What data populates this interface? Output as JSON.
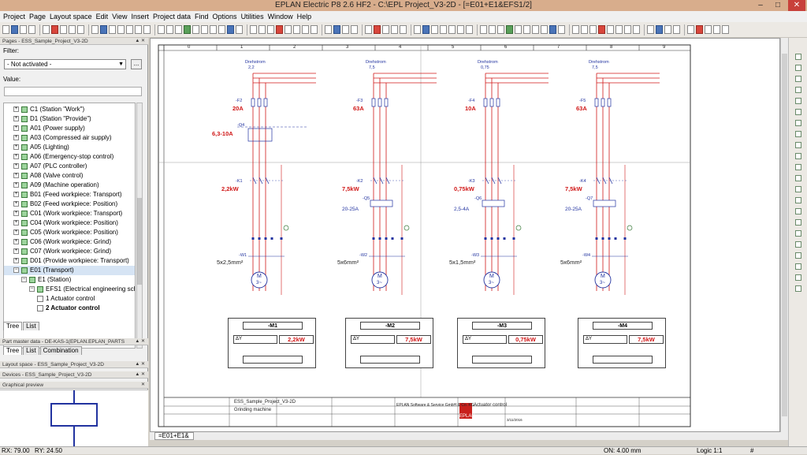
{
  "window": {
    "title": "EPLAN Electric P8 2.6 HF2 - C:\\EPL                               Project_V3-2D - [=E01+E1&EFS1/2]"
  },
  "menu": [
    "Project",
    "Page",
    "Layout space",
    "Edit",
    "View",
    "Insert",
    "Project data",
    "Find",
    "Options",
    "Utilities",
    "Window",
    "Help"
  ],
  "pages_panel": {
    "header": "Pages - ESS_Sample_Project_V3-2D",
    "filter_label": "Filter:",
    "filter_value": "- Not activated -",
    "filter_button": "...",
    "value_label": "Value:",
    "tree": [
      {
        "label": "C1 (Station \"Work\")",
        "level": 0,
        "icon": "station"
      },
      {
        "label": "D1 (Station \"Provide\")",
        "level": 0,
        "icon": "station"
      },
      {
        "label": "A01 (Power supply)",
        "level": 0,
        "icon": "location"
      },
      {
        "label": "A03 (Compressed air supply)",
        "level": 0,
        "icon": "location"
      },
      {
        "label": "A05 (Lighting)",
        "level": 0,
        "icon": "location"
      },
      {
        "label": "A06 (Emergency-stop control)",
        "level": 0,
        "icon": "location"
      },
      {
        "label": "A07 (PLC controller)",
        "level": 0,
        "icon": "location"
      },
      {
        "label": "A08 (Valve control)",
        "level": 0,
        "icon": "location"
      },
      {
        "label": "A09 (Machine operation)",
        "level": 0,
        "icon": "location"
      },
      {
        "label": "B01 (Feed workpiece: Transport)",
        "level": 0,
        "icon": "location"
      },
      {
        "label": "B02 (Feed workpiece: Position)",
        "level": 0,
        "icon": "location"
      },
      {
        "label": "C01 (Work workpiece: Transport)",
        "level": 0,
        "icon": "location"
      },
      {
        "label": "C04 (Work workpiece: Position)",
        "level": 0,
        "icon": "location"
      },
      {
        "label": "C05 (Work workpiece: Position)",
        "level": 0,
        "icon": "location"
      },
      {
        "label": "C06 (Work workpiece: Grind)",
        "level": 0,
        "icon": "location"
      },
      {
        "label": "C07 (Work workpiece: Grind)",
        "level": 0,
        "icon": "location"
      },
      {
        "label": "D01 (Provide workpiece: Transport)",
        "level": 0,
        "icon": "location"
      },
      {
        "label": "E01 (Transport)",
        "level": 0,
        "icon": "location",
        "expanded": true,
        "selected": true
      },
      {
        "label": "E1 (Station)",
        "level": 1,
        "icon": "station",
        "expanded": true
      },
      {
        "label": "EFS1 (Electrical engineering sch",
        "level": 2,
        "icon": "location",
        "expanded": true
      },
      {
        "label": "1 Actuator control",
        "level": 3,
        "icon": "page"
      },
      {
        "label": "2 Actuator control",
        "level": 3,
        "icon": "page",
        "bold": true
      }
    ],
    "tabs": [
      "Tree",
      "List"
    ]
  },
  "part_master_panel": {
    "header": "Part master data - DE-KAS-1(EPLAN.EPLAN_PARTS",
    "tabs": [
      "Tree",
      "List",
      "Combination"
    ]
  },
  "layout_space_panel": {
    "header": "Layout space - ESS_Sample_Project_V3-2D"
  },
  "devices_panel": {
    "header": "Devices - ESS_Sample_Project_V3-2D"
  },
  "graphical_preview_panel": {
    "header": "Graphical preview"
  },
  "schematic": {
    "column_numbers": [
      "0",
      "1",
      "2",
      "3",
      "4",
      "5",
      "6",
      "7",
      "8",
      "9"
    ],
    "supply_label": "Drehstrom",
    "supplies": [
      {
        "label": "Drehstrom",
        "value": "2,2"
      },
      {
        "label": "Drehstrom",
        "value": "7,5"
      },
      {
        "label": "Drehstrom",
        "value": "0,75"
      },
      {
        "label": "Drehstrom",
        "value": "7,5"
      }
    ],
    "fuses": [
      {
        "tag": "-F2",
        "rating": "20A"
      },
      {
        "tag": "-F3",
        "rating": "63A"
      },
      {
        "tag": "-F4",
        "rating": "10A"
      },
      {
        "tag": "-F5",
        "rating": "63A"
      }
    ],
    "q4_tag": "-Q4",
    "q4_range": "6,3-10A",
    "contactors": [
      {
        "tag": "-K1",
        "power": "2,2kW"
      },
      {
        "tag": "-K2",
        "power": "7,5kW"
      },
      {
        "tag": "-K3",
        "power": "0,75kW"
      },
      {
        "tag": "-K4",
        "power": "7,5kW"
      }
    ],
    "overloads": [
      {
        "tag": "-Q5",
        "range": "20-25A"
      },
      {
        "tag": "-Q6",
        "range": "2,5-4A"
      },
      {
        "tag": "-Q7",
        "range": "20-25A"
      }
    ],
    "cables": [
      {
        "tag": "-W1",
        "spec": "5x2,5mm²"
      },
      {
        "tag": "-W2",
        "spec": "5x6mm²"
      },
      {
        "tag": "-W3",
        "spec": "5x1,5mm²"
      },
      {
        "tag": "-W4",
        "spec": "5x6mm²"
      }
    ],
    "motor_symbol": {
      "letter": "M",
      "phase": "3~"
    },
    "motor_boxes": [
      {
        "tag": "-M1",
        "type": "ΔY",
        "power": "2,2kW"
      },
      {
        "tag": "-M2",
        "type": "ΔY",
        "power": "7,5kW"
      },
      {
        "tag": "-M3",
        "type": "ΔY",
        "power": "0,75kW"
      },
      {
        "tag": "-M4",
        "type": "ΔY",
        "power": "7,5kW"
      }
    ],
    "title_block": {
      "project_name": "ESS_Sample_Project_V3-2D",
      "machine": "Grinding machine",
      "company": "EPLAN Software & Service GmbH & Co. KG",
      "page_title": "Actuator control",
      "logo": "EPLAN",
      "date": "3/11/2016"
    }
  },
  "page_tab": "=E01+E1&",
  "status": {
    "rx": "RX: 79.00",
    "ry": "RY: 24.50",
    "on": "ON: 4.00 mm",
    "logic": "Logic 1:1",
    "hash": "#"
  },
  "colors": {
    "wire_red": "#d01818",
    "symbol_blue": "#2233a0",
    "titlebar": "#d8ad8c"
  }
}
